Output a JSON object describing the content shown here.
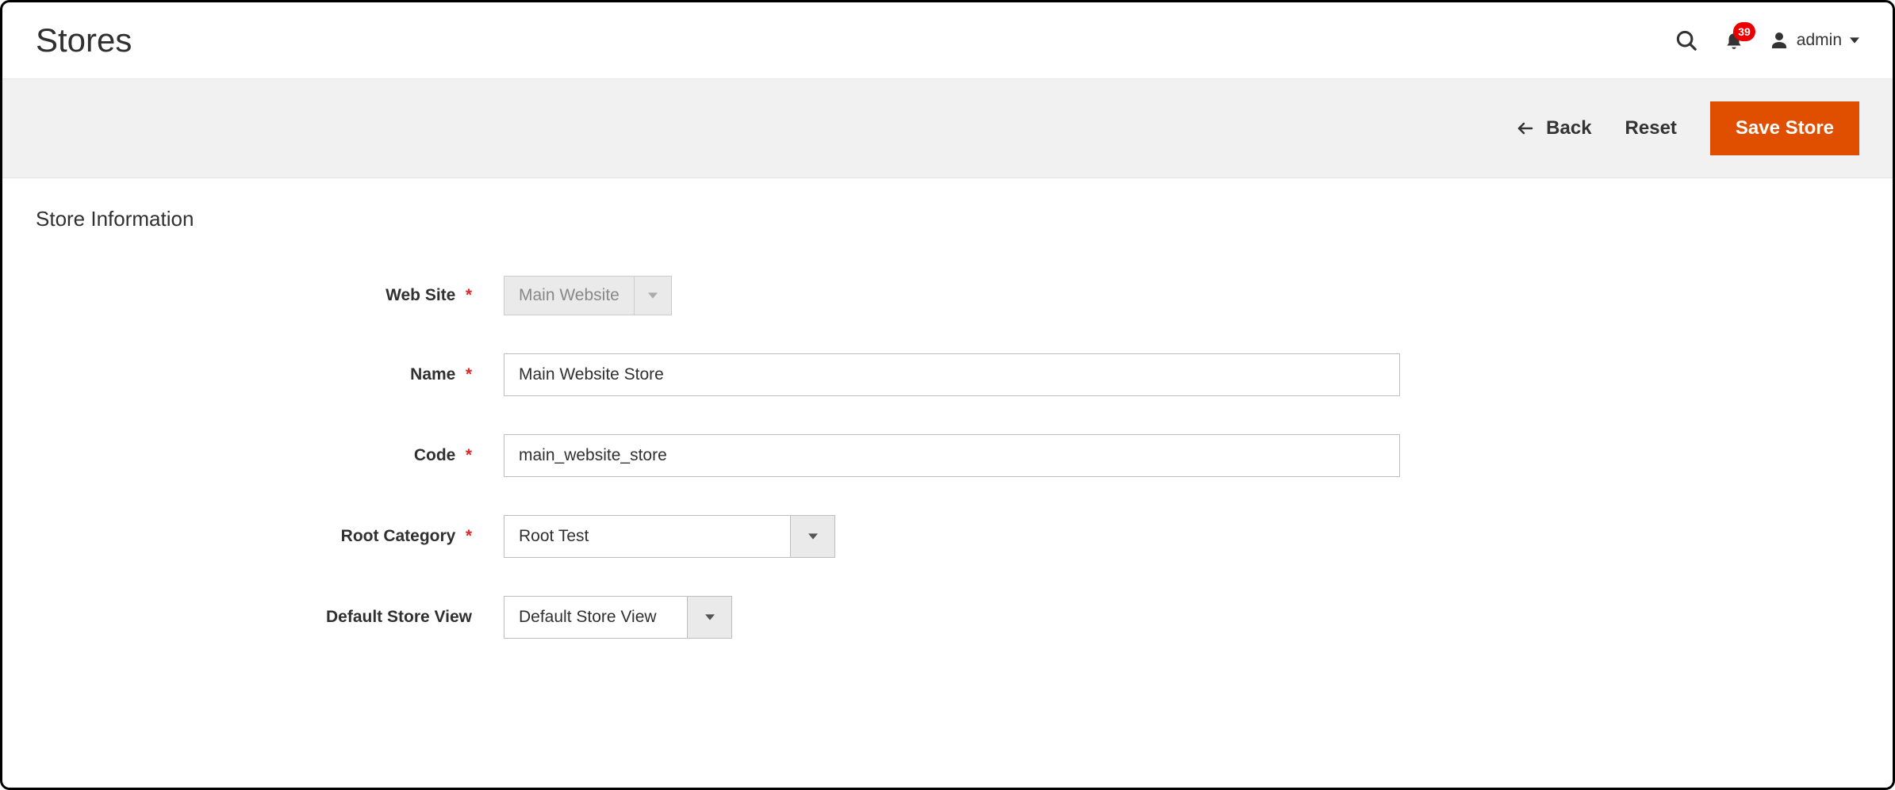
{
  "header": {
    "page_title": "Stores",
    "notification_count": "39",
    "admin_label": "admin"
  },
  "actions": {
    "back_label": "Back",
    "reset_label": "Reset",
    "save_label": "Save Store"
  },
  "section": {
    "title": "Store Information"
  },
  "form": {
    "website": {
      "label": "Web Site",
      "required": true,
      "value": "Main Website"
    },
    "name": {
      "label": "Name",
      "required": true,
      "value": "Main Website Store"
    },
    "code": {
      "label": "Code",
      "required": true,
      "value": "main_website_store"
    },
    "root_category": {
      "label": "Root Category",
      "required": true,
      "value": "Root Test"
    },
    "default_store_view": {
      "label": "Default Store View",
      "required": false,
      "value": "Default Store View"
    }
  }
}
